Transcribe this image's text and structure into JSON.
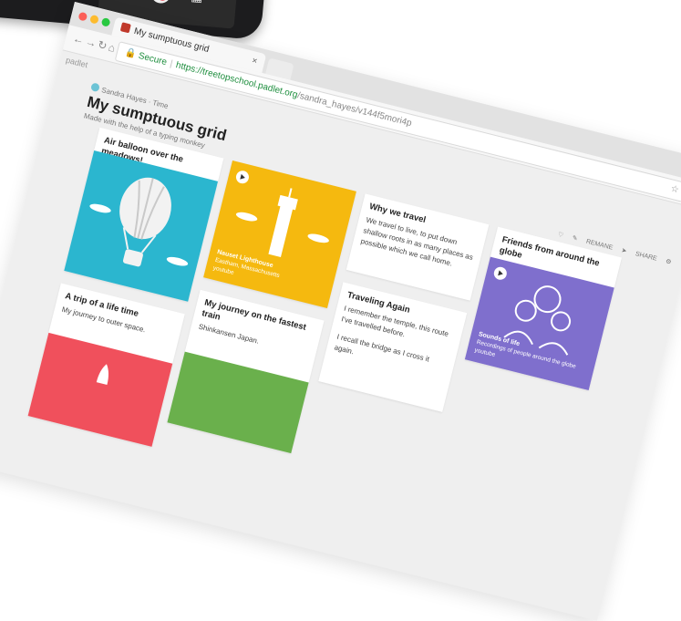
{
  "tab": {
    "title": "My sumptuous grid"
  },
  "address": {
    "secure_label": "Secure",
    "host": "https://treetopschool.padlet.org",
    "path": "/sandra_hayes/v144f5mori4p"
  },
  "brand": "padlet",
  "board": {
    "author": "Sandra Hayes",
    "time": "Time",
    "title": "My sumptuous grid",
    "subtitle": "Made with the help of a typing monkey"
  },
  "actions": {
    "rename": "REMANE",
    "share": "SHARE"
  },
  "cards": {
    "balloon": {
      "title": "Air balloon over the meadows!"
    },
    "lighthouse": {
      "caption_title": "Nauset Lighthouse",
      "caption_line": "Eastham, Massachusetts",
      "caption_source": "youtube"
    },
    "why": {
      "title": "Why we travel",
      "body": "We travel to live, to put down shallow roots in as many places as possible which we call home."
    },
    "friends": {
      "title": "Friends from around the globe",
      "caption_title": "Sounds of life",
      "caption_line": "Recordings of people around the globe",
      "caption_source": "youtube"
    },
    "trip": {
      "title": "A trip of a life time",
      "body": "My journey to outer space."
    },
    "train": {
      "title": "My journey on the fastest train",
      "body": "Shinkansen Japan."
    },
    "again": {
      "title": "Traveling Again",
      "body1": "I remember the temple, this route I've travelled before.",
      "body2": "I recall the bridge as I cross it again."
    }
  },
  "colors": {
    "teal": "#2bb6cf",
    "yellow": "#f5b90f",
    "purple": "#7f6fcd",
    "red": "#f0505c",
    "green": "#6ab04c"
  }
}
